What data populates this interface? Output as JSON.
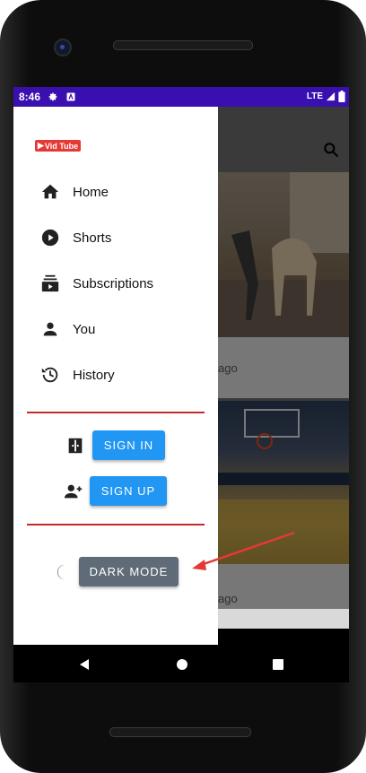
{
  "status_bar": {
    "time": "8:46",
    "network": "LTE"
  },
  "app": {
    "logo_text": "Vid Tube"
  },
  "nav": {
    "items": [
      {
        "label": "Home",
        "icon": "home-icon"
      },
      {
        "label": "Shorts",
        "icon": "play-circle-icon"
      },
      {
        "label": "Subscriptions",
        "icon": "subscriptions-icon"
      },
      {
        "label": "You",
        "icon": "person-icon"
      },
      {
        "label": "History",
        "icon": "history-icon"
      }
    ]
  },
  "auth": {
    "sign_in_label": "SIGN IN",
    "sign_up_label": "SIGN UP"
  },
  "theme": {
    "dark_mode_label": "DARK MODE"
  },
  "feed": {
    "video1_meta": "ago",
    "video2_meta": "ago"
  },
  "colors": {
    "status_bar": "#3a0fb0",
    "button_blue": "#2196f3",
    "divider": "#c62828",
    "dark_mode_button": "#5f6b76",
    "annotation_arrow": "#e53935"
  }
}
